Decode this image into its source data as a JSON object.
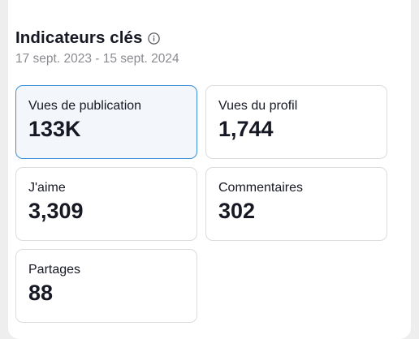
{
  "panel": {
    "title": "Indicateurs clés",
    "info_icon": "info-circle-icon",
    "date_range": "17 sept. 2023 - 15 sept. 2024"
  },
  "metrics": [
    {
      "label": "Vues de publication",
      "value": "133K",
      "selected": true
    },
    {
      "label": "Vues du profil",
      "value": "1,744",
      "selected": false
    },
    {
      "label": "J'aime",
      "value": "3,309",
      "selected": false
    },
    {
      "label": "Commentaires",
      "value": "302",
      "selected": false
    },
    {
      "label": "Partages",
      "value": "88",
      "selected": false
    }
  ],
  "colors": {
    "accent_border": "#3a8fd6",
    "selected_bg": "#f3f7fb",
    "text_primary": "#161823",
    "text_secondary": "#8a8b91"
  }
}
